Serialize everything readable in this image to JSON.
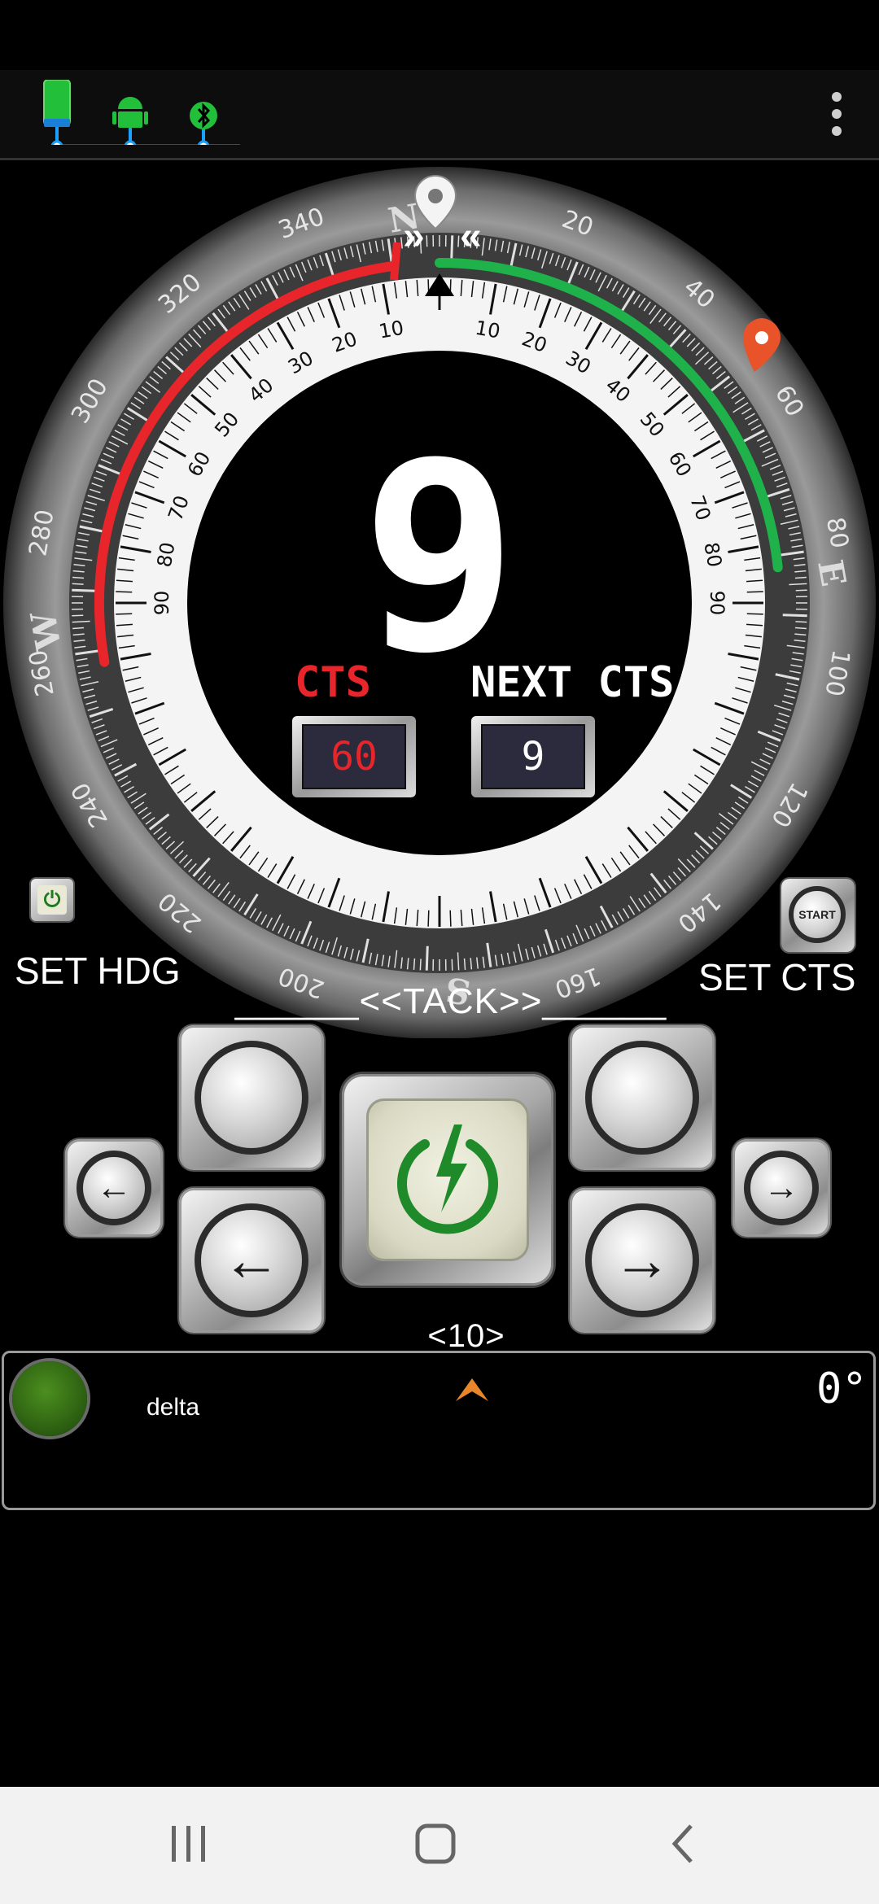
{
  "toolbar": {
    "status_icons": [
      "phone-icon",
      "android-icon",
      "bluetooth-icon"
    ],
    "menu_icon": "more-vertical-icon"
  },
  "compass": {
    "heading_display": "9",
    "cts_label": "CTS",
    "next_cts_label": "NEXT CTS",
    "cts_value": "60",
    "next_cts_value": "9",
    "cardinals": {
      "n": "N",
      "e": "E",
      "s": "S",
      "w": "W"
    },
    "outer_scale": [
      "20",
      "40",
      "60",
      "80",
      "100",
      "120",
      "140",
      "160",
      "200",
      "220",
      "240",
      "260",
      "280",
      "300",
      "320",
      "340"
    ],
    "inner_scale_right": [
      "10",
      "20",
      "30",
      "40",
      "50",
      "60",
      "70",
      "80",
      "90"
    ],
    "inner_scale_left": [
      "10",
      "20",
      "30",
      "40",
      "50",
      "60",
      "70",
      "80",
      "90"
    ],
    "colors": {
      "port": "#e8252a",
      "starboard": "#20b24a",
      "cts": "#e8252a",
      "target_pin": "#e8532a"
    }
  },
  "controls": {
    "set_hdg_label": "SET HDG",
    "set_cts_label": "SET CTS",
    "start_label": "START",
    "tack_label": "______<<TACK>>______",
    "step_label": "_______<10>_______"
  },
  "info": {
    "delta_label": "delta",
    "degree_value": "0°",
    "status_color": "#3d7a1a"
  },
  "nav": {
    "recents_icon": "recents-icon",
    "home_icon": "home-icon",
    "back_icon": "back-icon"
  }
}
